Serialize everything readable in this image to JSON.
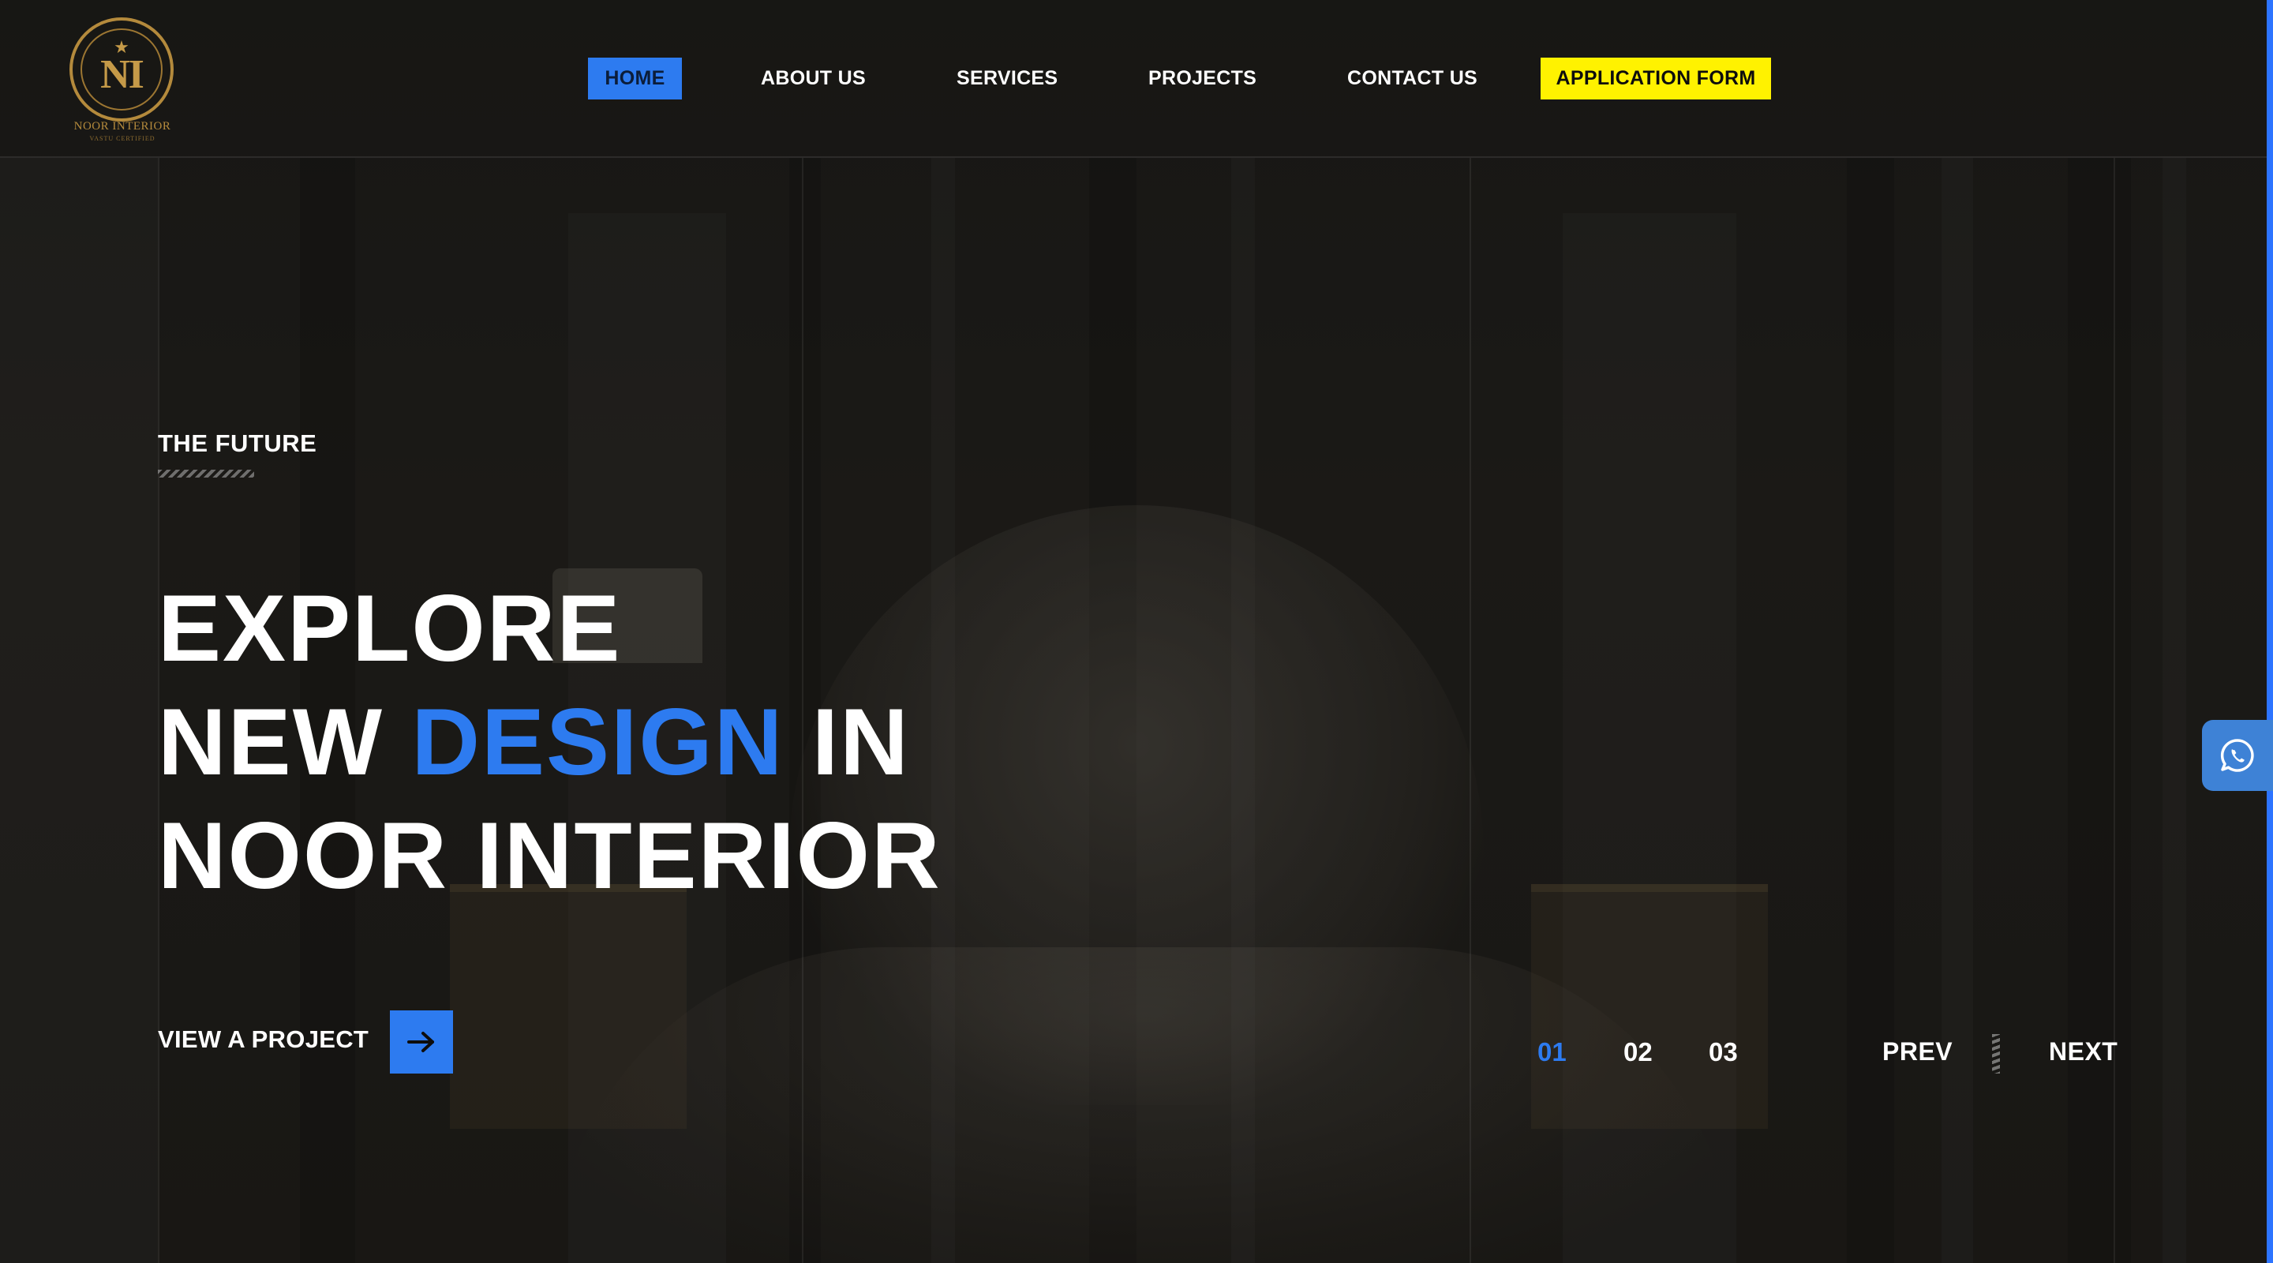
{
  "brand": {
    "monogram": "NI",
    "name": "NOOR INTERIOR",
    "tagline": "VASTU CERTIFIED",
    "star": "★"
  },
  "nav": {
    "home": "HOME",
    "about": "ABOUT US",
    "services": "SERVICES",
    "projects": "PROJECTS",
    "contact": "CONTACT US",
    "application": "APPLICATION FORM"
  },
  "hero": {
    "eyebrow": "THE FUTURE",
    "line1": "EXPLORE",
    "line2_pre": "NEW",
    "line2_accent": "DESIGN",
    "line2_post": "IN",
    "line3": "NOOR INTERIOR",
    "cta_label": "VIEW A PROJECT"
  },
  "slider": {
    "slides": [
      "01",
      "02",
      "03"
    ],
    "active_index": 0,
    "prev": "PREV",
    "next": "NEXT"
  },
  "icons": {
    "cta_arrow": "arrow-right-icon",
    "floating": "whatsapp-icon"
  },
  "colors": {
    "accent": "#2d7bf0",
    "cta_highlight": "#fff200",
    "logo_gold": "#b48a3c",
    "background": "#1c1b19"
  }
}
